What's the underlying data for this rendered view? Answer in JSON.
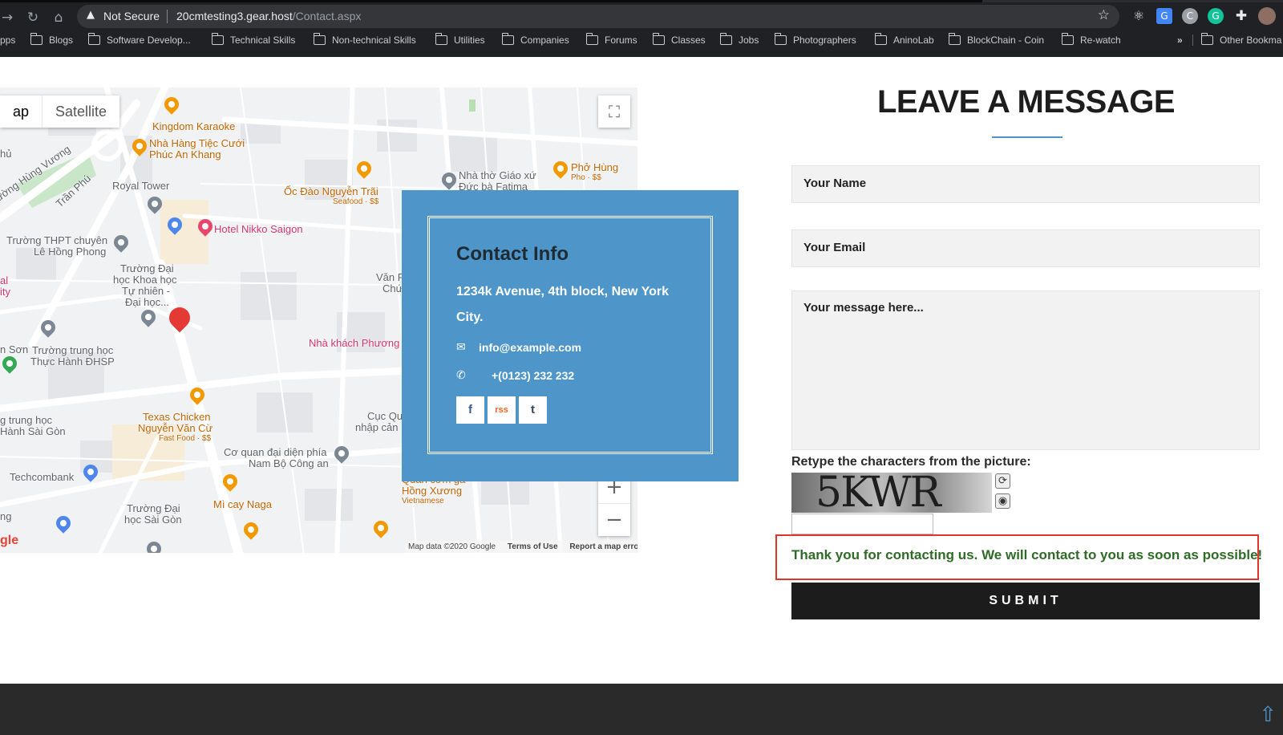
{
  "browser": {
    "security_icon": "warning-triangle-icon",
    "security_text": "Not Secure",
    "url_host": "20cmtesting3.gear.host",
    "url_path": "/Contact.aspx",
    "bookmarks": [
      "pps",
      "Blogs",
      "Software Develop...",
      "Technical Skills",
      "Non-technical Skills",
      "Utilities",
      "Companies",
      "Forums",
      "Classes",
      "Jobs",
      "Photographers",
      "AninoLab",
      "BlockChain - Coin",
      "Re-watch"
    ],
    "more_bookmarks": "»",
    "other_bookmarks": "Other Bookma"
  },
  "map": {
    "type_map": "ap",
    "type_satellite": "Satellite",
    "zoom_in": "+",
    "zoom_out": "−",
    "google_logo": "gle",
    "attribution": "Map data ©2020 Google",
    "terms": "Terms of Use",
    "report": "Report a map error",
    "labels": {
      "kingdom_karaoke": "Kingdom Karaoke",
      "nha_hang_1": "Nhà Hàng Tiệc Cưới",
      "nha_hang_2": "Phúc An Khang",
      "hung_vuong": "ường Hùng Vương",
      "tran_phu": "Trần Phú",
      "royal_tower": "Royal Tower",
      "oc_dao_1": "Ốc Đào Nguyễn Trãi",
      "oc_dao_2": "Seafood · $$",
      "nha_tho_1": "Nhà thờ Giáo xứ",
      "nha_tho_2": "Đức bà Fatima",
      "pho_hung_1": "Phở Hùng",
      "pho_hung_2": "Pho · $$",
      "hotel_nikko": "Hotel Nikko Saigon",
      "truong_thpt_1": "Trường THPT chuyên",
      "truong_thpt_2": "Lê Hồng Phong",
      "khoa_hoc_1": "Trường Đại",
      "khoa_hoc_2": "học Khoa học",
      "khoa_hoc_3": "Tự nhiên -",
      "khoa_hoc_4": "Đại học...",
      "van_1": "Văn P",
      "van_2": "Chứ",
      "hu": "hủ",
      "al_1": "al",
      "al_2": "ity",
      "nha_khach": "Nhà khách Phương",
      "n_son": "n Sơn",
      "truong_trung_1": "Trường trung học",
      "truong_trung_2": "Thực Hành ĐHSP",
      "g_trung_1": "g trung học",
      "g_trung_2": "Hành Sài Gòn",
      "texas_1": "Texas Chicken",
      "texas_2": "Nguyễn Văn Cừ",
      "texas_3": "Fast Food · $$",
      "cuc_1": "Cục Qu",
      "cuc_2": "nhập cản",
      "co_quan_1": "Cơ quan đại diện phía",
      "co_quan_2": "Nam Bộ Công an",
      "techcombank": "Techcombank",
      "quan_com_1": "Quán cơm gà",
      "quan_com_2": "Hồng Xương",
      "quan_com_3": "Vietnamese",
      "mi_cay": "Mì cay Naga",
      "ng": "ng",
      "sai_gon_1": "Trường Đại",
      "sai_gon_2": "học Sài Gòn"
    }
  },
  "contact": {
    "title": "Contact Info",
    "address": "1234k Avenue, 4th block, New York City.",
    "email": "info@example.com",
    "phone": "+(0123) 232 232",
    "socials": [
      "f",
      "rss",
      "t"
    ]
  },
  "form": {
    "title": "LEAVE A MESSAGE",
    "name_placeholder": "Your Name",
    "email_placeholder": "Your Email",
    "message_placeholder": "Your message here...",
    "captcha_label": "Retype the characters from the picture:",
    "captcha_text": "5KWR",
    "thanks": "Thank you for contacting us. We will contact to you as soon as possible!",
    "submit": "SUBMIT"
  },
  "colors": {
    "accent": "#4e96c9",
    "success_text": "#2e6b26",
    "error_border": "#e0352b",
    "button_bg": "#1c1c1c",
    "footer_bg": "#2a2a2a"
  }
}
